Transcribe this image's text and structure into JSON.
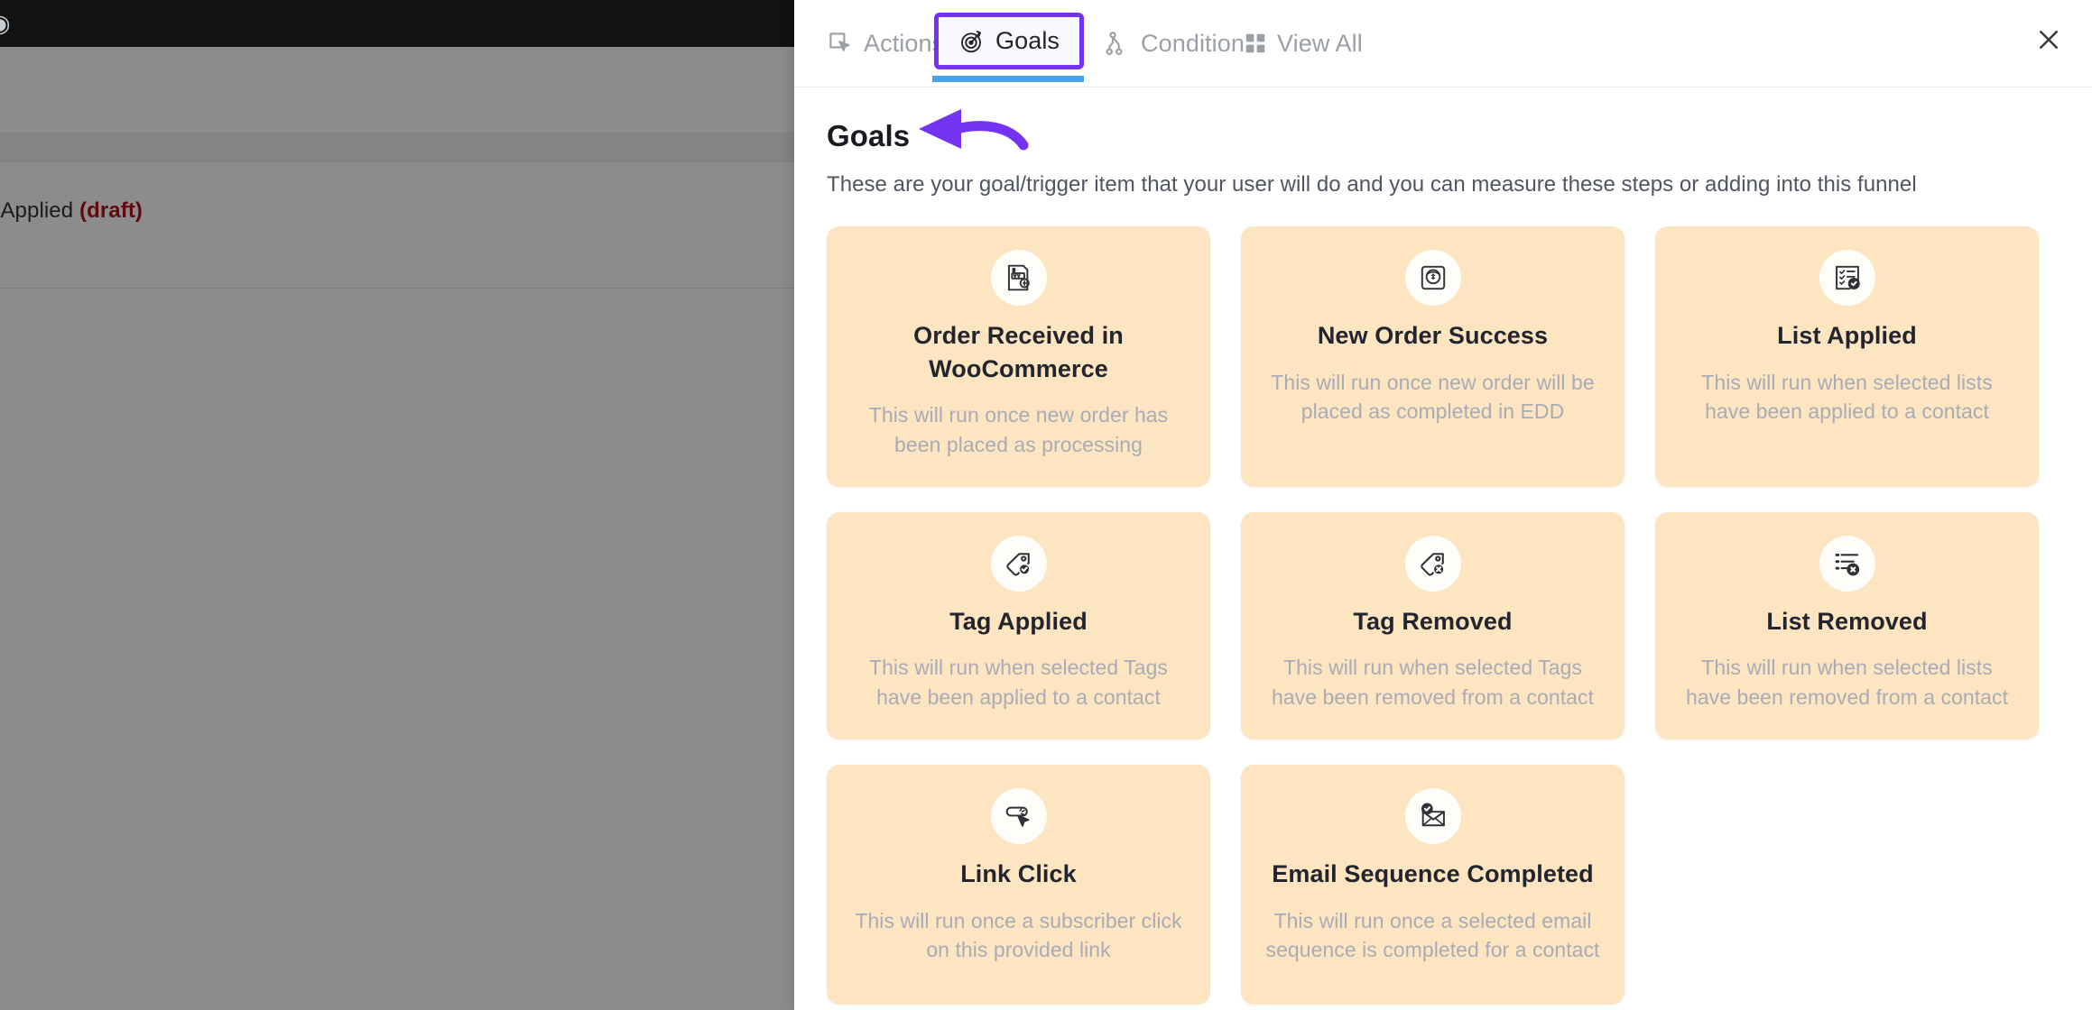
{
  "background": {
    "admin_bar_glyph": "◉",
    "node_title": "Tag Applied",
    "node_status": "(draft)"
  },
  "panel": {
    "close_icon": "close-icon",
    "tabs": [
      {
        "label": "Actions",
        "icon": "actions-cursor-icon",
        "active": false
      },
      {
        "label": "Goals",
        "icon": "target-icon",
        "active": true
      },
      {
        "label": "Condition",
        "icon": "branch-icon",
        "active": false
      },
      {
        "label": "View All",
        "icon": "grid-icon",
        "active": false
      }
    ],
    "heading": "Goals",
    "description": "These are your goal/trigger item that your user will do and you can measure these steps or adding into this funnel",
    "goals": [
      {
        "title": "Order Received in WooCommerce",
        "description": "This will run once new order has been placed as processing",
        "icon": "woocommerce-order-icon",
        "row": "r1"
      },
      {
        "title": "New Order Success",
        "description": "This will run once new order will be placed as completed in EDD",
        "icon": "edd-order-icon",
        "row": "r1"
      },
      {
        "title": "List Applied",
        "description": "This will run when selected lists have been applied to a contact",
        "icon": "list-check-icon",
        "row": "r1"
      },
      {
        "title": "Tag Applied",
        "description": "This will run when selected Tags have been applied to a contact",
        "icon": "tag-check-icon",
        "row": "r2"
      },
      {
        "title": "Tag Removed",
        "description": "This will run when selected Tags have been removed from a contact",
        "icon": "tag-remove-icon",
        "row": "r2"
      },
      {
        "title": "List Removed",
        "description": "This will run when selected lists have been removed from a contact",
        "icon": "list-remove-icon",
        "row": "r2"
      },
      {
        "title": "Link Click",
        "description": "This will run once a subscriber click on this provided link",
        "icon": "link-click-icon",
        "row": "r3"
      },
      {
        "title": "Email Sequence Completed",
        "description": "This will run once a selected email sequence is completed for a contact",
        "icon": "email-check-icon",
        "row": "r3"
      }
    ]
  },
  "colors": {
    "accent_purple": "#7433f0",
    "tab_underline_blue": "#4aa3e8",
    "card_bg": "#fce5c0",
    "draft_red": "#b3121b",
    "title_dark": "#22242e",
    "desc_grey": "#a9acb6"
  }
}
